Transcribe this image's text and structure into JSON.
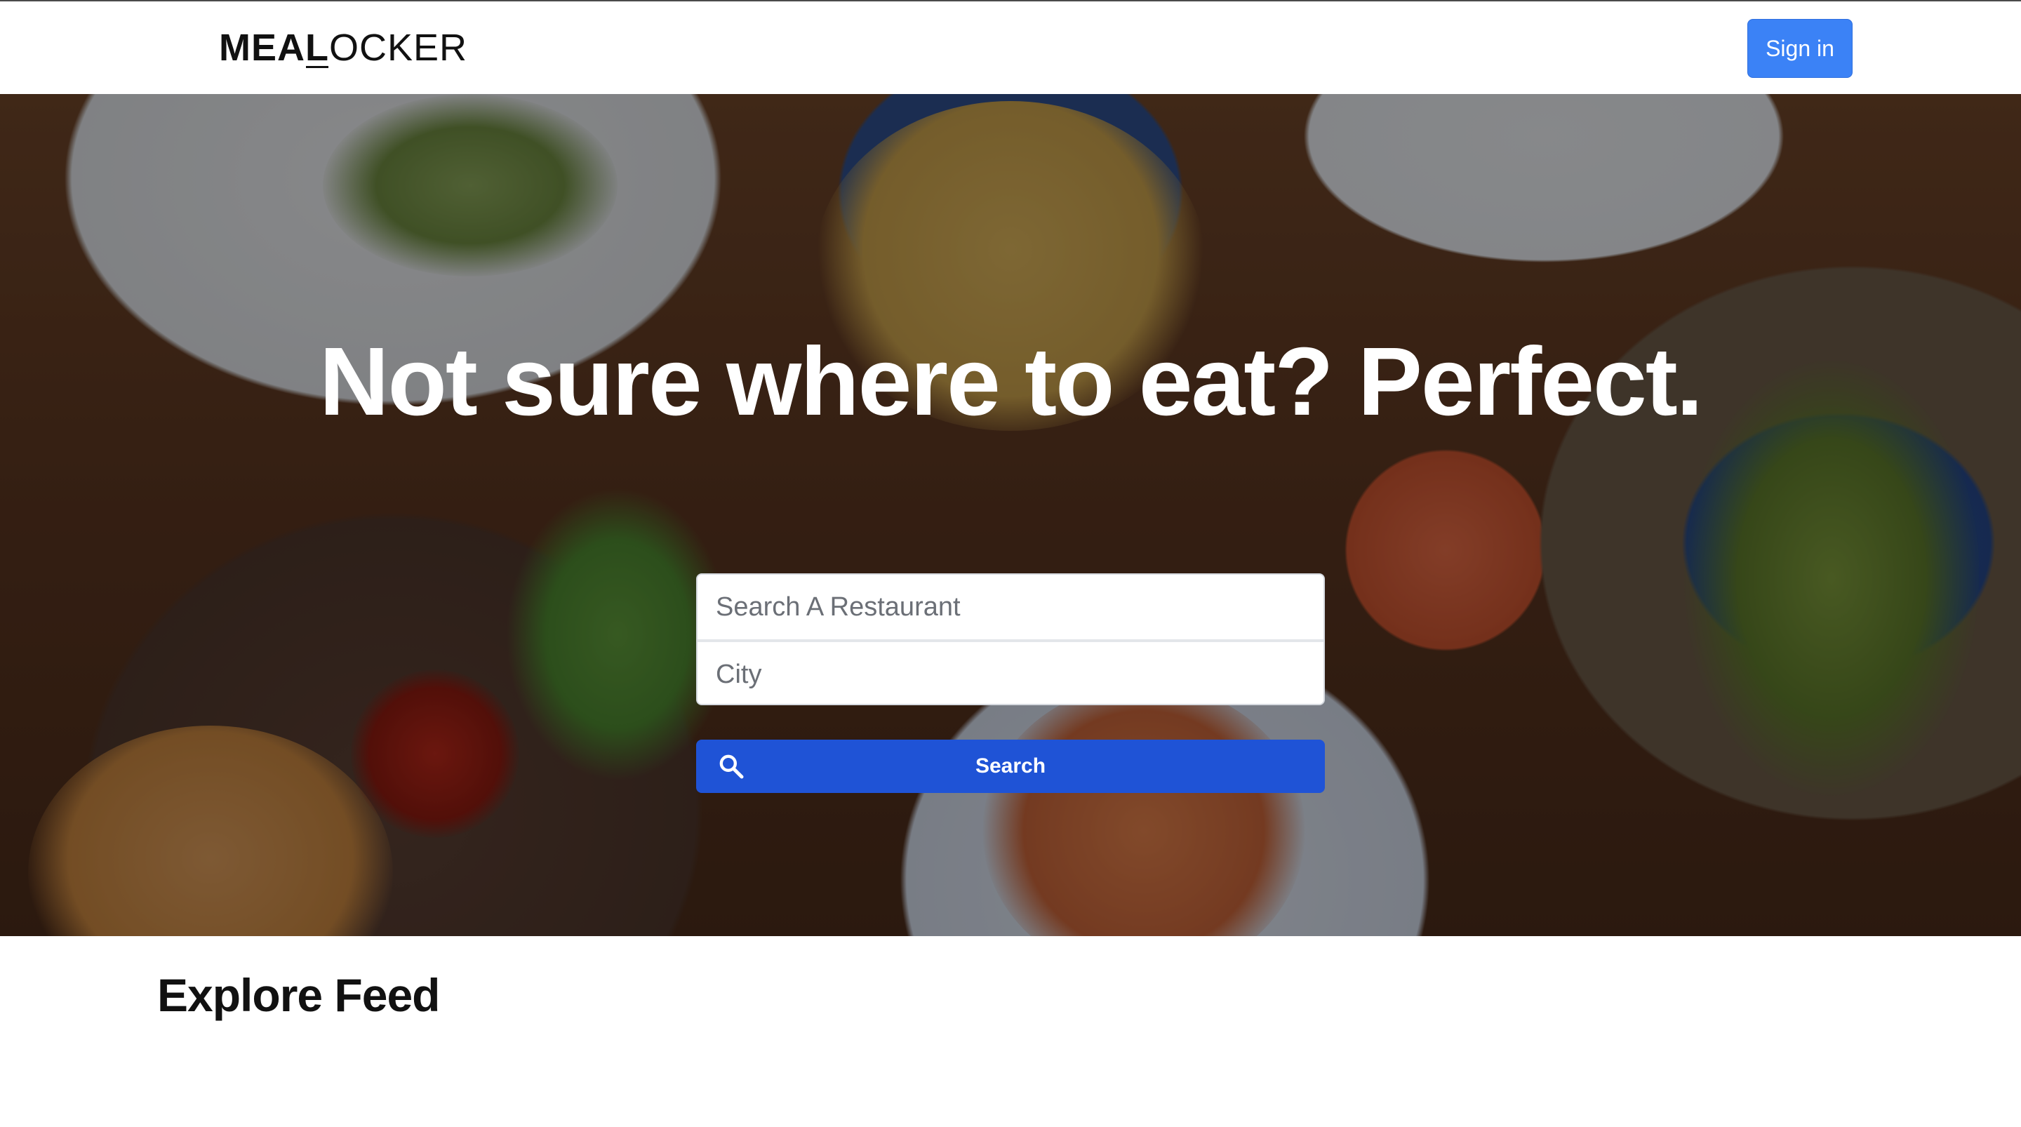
{
  "navbar": {
    "logo_bold": "MEAL",
    "logo_light": "OCKER",
    "signin_label": "Sign in"
  },
  "hero": {
    "title": "Not sure where to eat? Perfect.",
    "search": {
      "restaurant_placeholder": "Search A Restaurant",
      "restaurant_value": "",
      "city_placeholder": "City",
      "city_value": "",
      "button_label": "Search",
      "button_icon": "search-icon"
    }
  },
  "feed": {
    "title": "Explore Feed"
  },
  "colors": {
    "signin_bg": "#3b82f6",
    "search_btn_bg": "#1f53d6",
    "text_dark": "#111111"
  }
}
